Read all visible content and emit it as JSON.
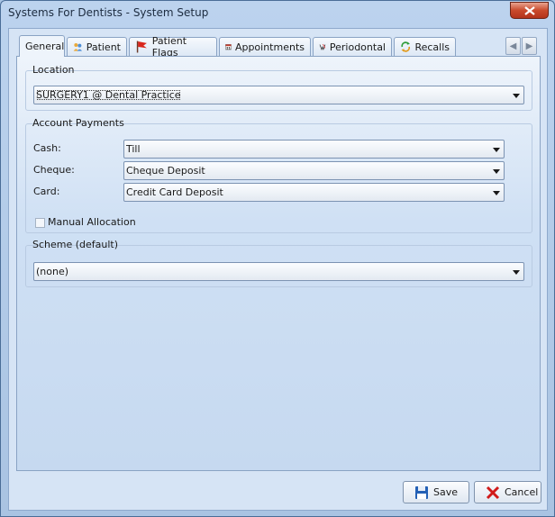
{
  "window": {
    "title": "Systems For Dentists - System Setup"
  },
  "tabs": [
    {
      "label": "General",
      "icon": "none"
    },
    {
      "label": "Patient",
      "icon": "patient-icon"
    },
    {
      "label": "Patient Flags",
      "icon": "flag-icon"
    },
    {
      "label": "Appointments",
      "icon": "calendar-icon",
      "icon_text": "21"
    },
    {
      "label": "Periodontal",
      "icon": "periodontal-icon"
    },
    {
      "label": "Recalls",
      "icon": "recall-icon"
    }
  ],
  "location": {
    "label": "Location",
    "value": "SURGERY1 @ Dental Practice"
  },
  "account_payments": {
    "label": "Account Payments",
    "cash": {
      "label": "Cash:",
      "value": "Till"
    },
    "cheque": {
      "label": "Cheque:",
      "value": "Cheque Deposit"
    },
    "card": {
      "label": "Card:",
      "value": "Credit Card Deposit"
    },
    "manual_allocation": {
      "label": "Manual Allocation",
      "checked": false
    }
  },
  "scheme": {
    "label": "Scheme (default)",
    "value": "(none)"
  },
  "buttons": {
    "save": "Save",
    "cancel": "Cancel"
  },
  "colors": {
    "accent": "#c94a2c",
    "background": "#d6e4f5"
  }
}
